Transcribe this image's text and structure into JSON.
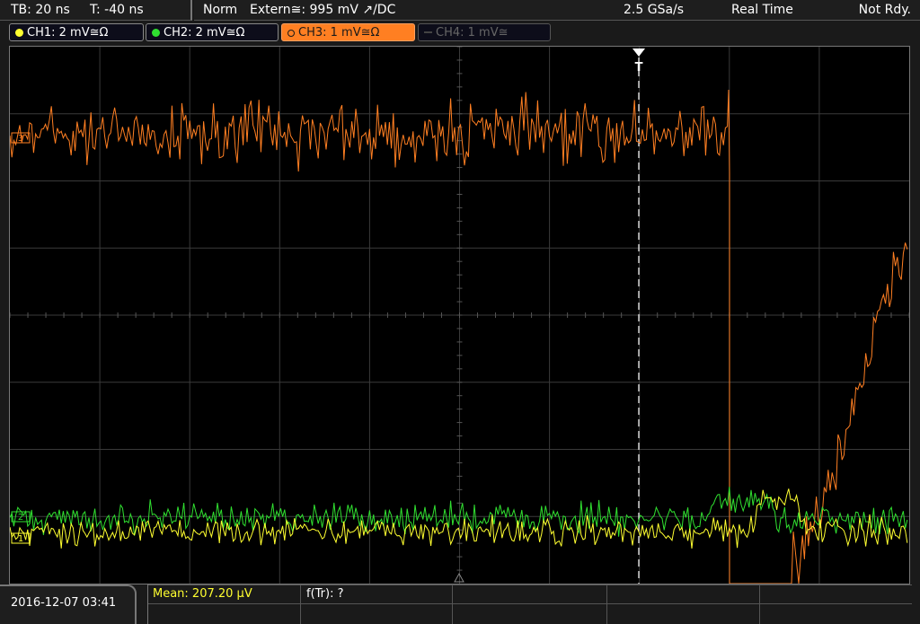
{
  "header": {
    "timebase": "TB: 20 ns",
    "trigger_time": "T: -40 ns",
    "mode": "Norm",
    "trigger_source": "Extern≅: 995 mV ↗/DC",
    "sample_rate": "2.5 GSa/s",
    "acq_mode": "Real Time",
    "status": "Not Rdy."
  },
  "channels": [
    {
      "label": "CH1: 2 mV≅Ω",
      "color": "#ffff30",
      "state": "on"
    },
    {
      "label": "CH2: 2 mV≅Ω",
      "color": "#30e030",
      "state": "on"
    },
    {
      "label": "CH3: 1 mV≅Ω",
      "color": "#ff7f22",
      "state": "active"
    },
    {
      "label": "CH4: 1 mV≅",
      "color": "#666666",
      "state": "off"
    }
  ],
  "markers": {
    "ch3": "3",
    "ch2": "2",
    "ch1": "1",
    "trigger": "T"
  },
  "footer": {
    "datetime": "2016-12-07 03:41",
    "mean": "Mean: 207.20 µV",
    "freq": "f(Tr): ?"
  },
  "colors": {
    "ch1": "#ffff30",
    "ch2": "#30e030",
    "ch3": "#ff7f22",
    "grid": "#3a3a3a",
    "background": "#000000"
  }
}
